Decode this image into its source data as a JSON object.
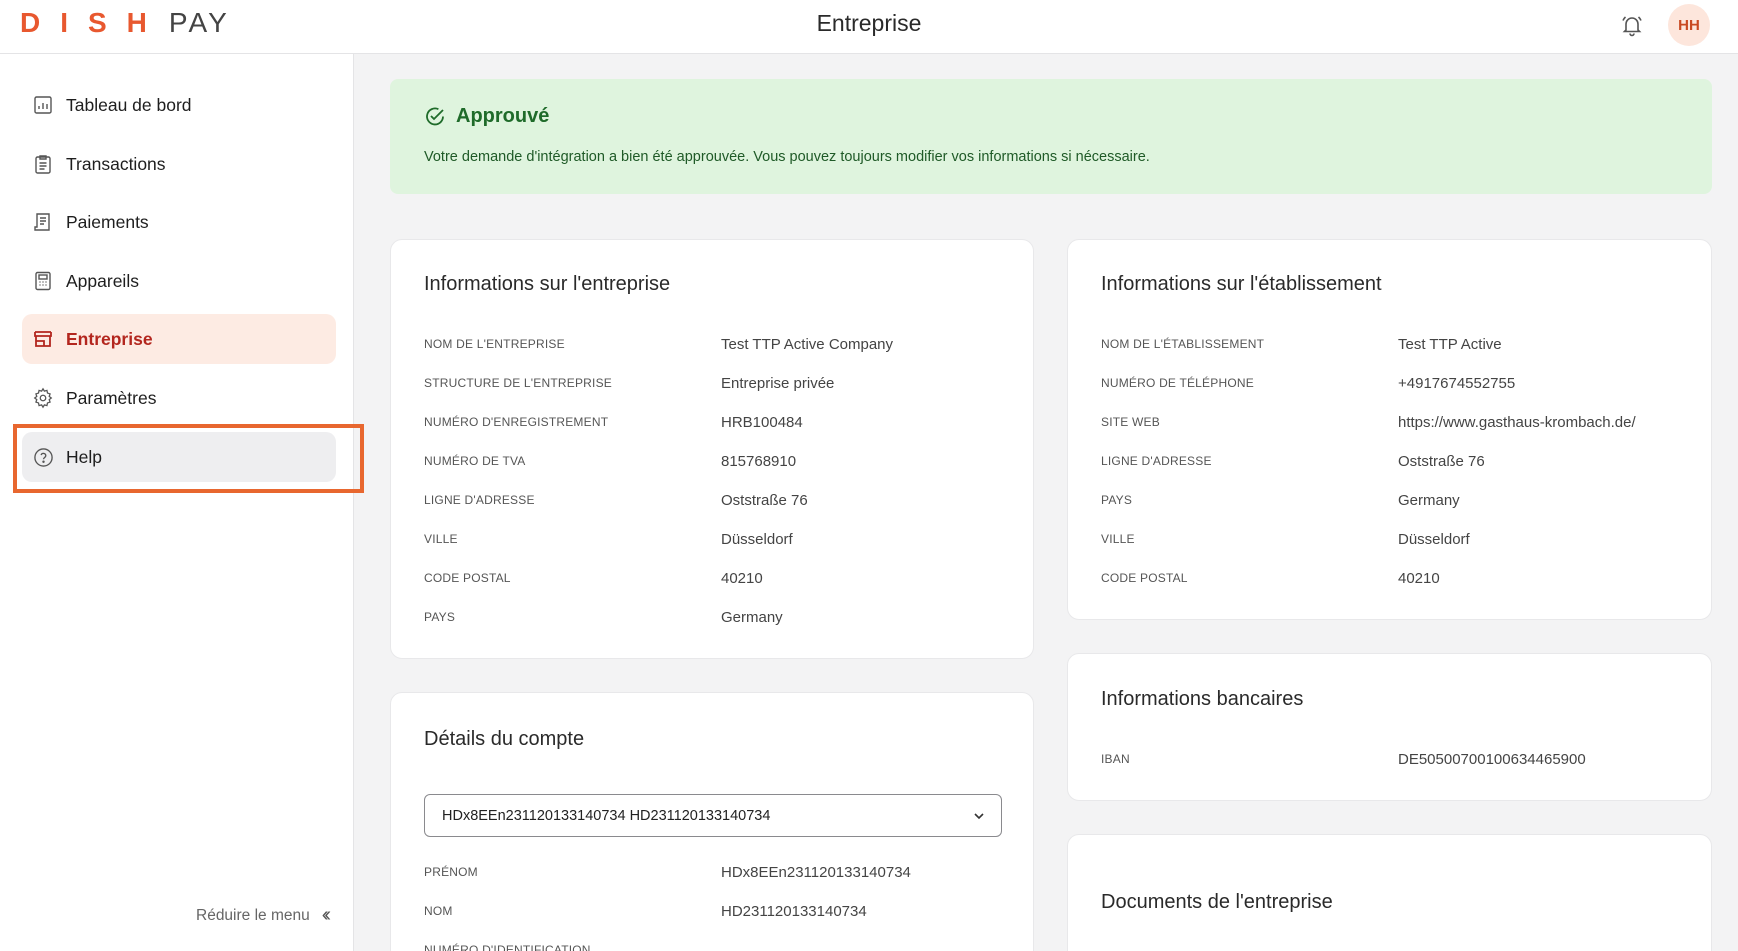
{
  "app": {
    "logo_dish": "DISH",
    "logo_pay": "PAY",
    "page_title": "Entreprise",
    "avatar_initials": "HH"
  },
  "sidebar": {
    "items": [
      {
        "label": "Tableau de bord",
        "icon": "dashboard-icon"
      },
      {
        "label": "Transactions",
        "icon": "clipboard-icon"
      },
      {
        "label": "Paiements",
        "icon": "receipt-icon"
      },
      {
        "label": "Appareils",
        "icon": "device-icon"
      },
      {
        "label": "Entreprise",
        "icon": "store-icon",
        "active": true
      },
      {
        "label": "Paramètres",
        "icon": "gear-icon"
      },
      {
        "label": "Help",
        "icon": "help-icon",
        "highlighted": true
      }
    ],
    "collapse_label": "Réduire le menu"
  },
  "banner": {
    "title": "Approuvé",
    "text": "Votre demande d'intégration a bien été approuvée. Vous pouvez toujours modifier vos informations si nécessaire."
  },
  "company_info": {
    "title": "Informations sur l'entreprise",
    "rows": [
      {
        "label": "NOM DE L'ENTREPRISE",
        "value": "Test TTP Active Company"
      },
      {
        "label": "STRUCTURE DE L'ENTREPRISE",
        "value": "Entreprise privée"
      },
      {
        "label": "NUMÉRO D'ENREGISTREMENT",
        "value": "HRB100484"
      },
      {
        "label": "NUMÉRO DE TVA",
        "value": "815768910"
      },
      {
        "label": "LIGNE D'ADRESSE",
        "value": "Oststraße 76"
      },
      {
        "label": "VILLE",
        "value": "Düsseldorf"
      },
      {
        "label": "CODE POSTAL",
        "value": "40210"
      },
      {
        "label": "PAYS",
        "value": "Germany"
      }
    ]
  },
  "establishment_info": {
    "title": "Informations sur l'établissement",
    "rows": [
      {
        "label": "NOM DE L'ÉTABLISSEMENT",
        "value": "Test TTP Active"
      },
      {
        "label": "NUMÉRO DE TÉLÉPHONE",
        "value": "+4917674552755"
      },
      {
        "label": "SITE WEB",
        "value": "https://www.gasthaus-krombach.de/"
      },
      {
        "label": "LIGNE D'ADRESSE",
        "value": "Oststraße 76"
      },
      {
        "label": "PAYS",
        "value": "Germany"
      },
      {
        "label": "VILLE",
        "value": "Düsseldorf"
      },
      {
        "label": "CODE POSTAL",
        "value": "40210"
      }
    ]
  },
  "bank_info": {
    "title": "Informations bancaires",
    "rows": [
      {
        "label": "IBAN",
        "value": "DE50500700100634465900"
      }
    ]
  },
  "account_details": {
    "title": "Détails du compte",
    "selected_account": "HDx8EEn231120133140734 HD231120133140734",
    "rows": [
      {
        "label": "PRÉNOM",
        "value": "HDx8EEn231120133140734"
      },
      {
        "label": "NOM",
        "value": "HD231120133140734"
      },
      {
        "label": "NUMÉRO D'IDENTIFICATION",
        "value": ""
      }
    ]
  },
  "documents": {
    "title": "Documents de l'entreprise"
  }
}
